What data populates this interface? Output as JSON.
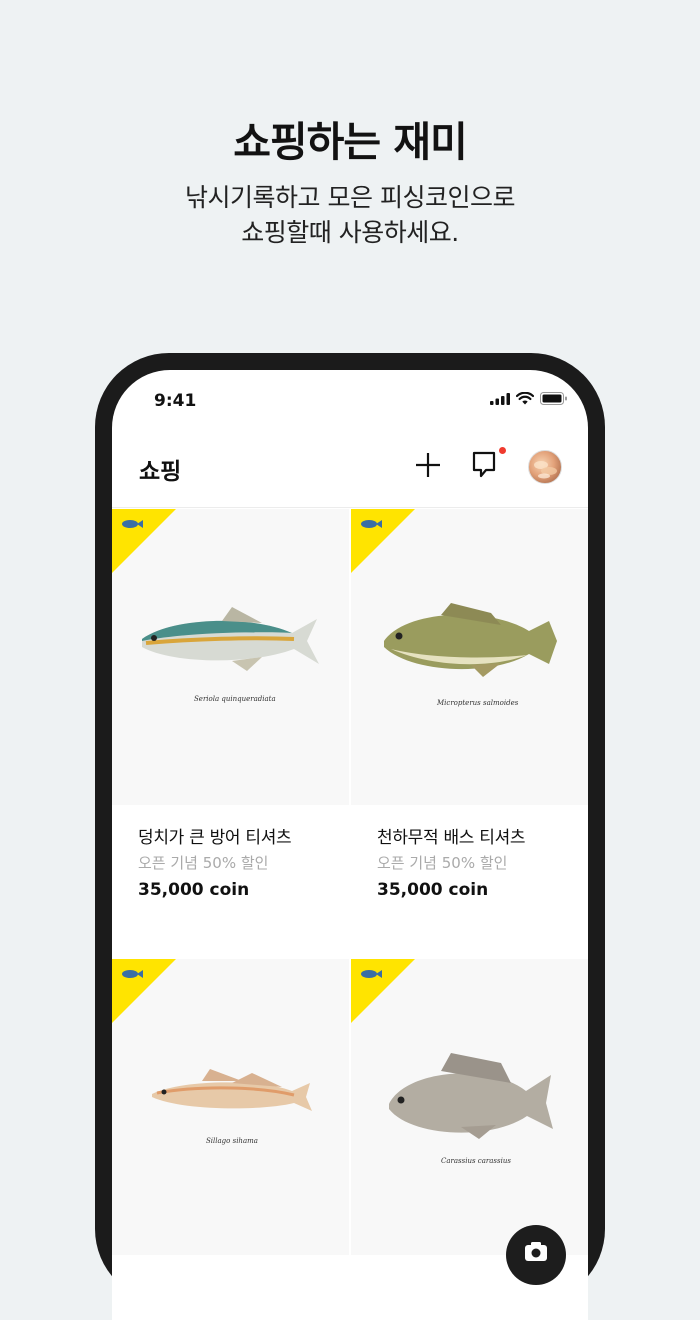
{
  "promo": {
    "headline": "쇼핑하는 재미",
    "subline_1": "낚시기록하고 모은 피싱코인으로",
    "subline_2": "쇼핑할때 사용하세요."
  },
  "status_bar": {
    "time": "9:41",
    "icons": [
      "signal-icon",
      "wifi-icon",
      "battery-icon"
    ]
  },
  "header": {
    "title": "쇼핑",
    "actions": [
      "plus-icon",
      "chat-icon",
      "avatar"
    ],
    "chat_has_notification": true
  },
  "products": [
    {
      "name": "덩치가 큰 방어 티셔츠",
      "promo": "오픈 기념 50% 할인",
      "price": "35,000 coin",
      "caption": "Seriola quinqueradiata",
      "badge_icon": "fish-icon"
    },
    {
      "name": "천하무적 배스 티셔츠",
      "promo": "오픈 기념 50% 할인",
      "price": "35,000 coin",
      "caption": "Micropterus salmoides",
      "badge_icon": "fish-icon"
    },
    {
      "name": "",
      "promo": "",
      "price": "",
      "caption": "Sillago sihama",
      "badge_icon": "fish-icon"
    },
    {
      "name": "",
      "promo": "",
      "price": "",
      "caption": "Carassius carassius",
      "badge_icon": "fish-icon"
    }
  ],
  "colors": {
    "background": "#eef2f3",
    "badge": "#ffe400",
    "notification": "#f03a2e",
    "phone_frame": "#1b1b1b"
  }
}
